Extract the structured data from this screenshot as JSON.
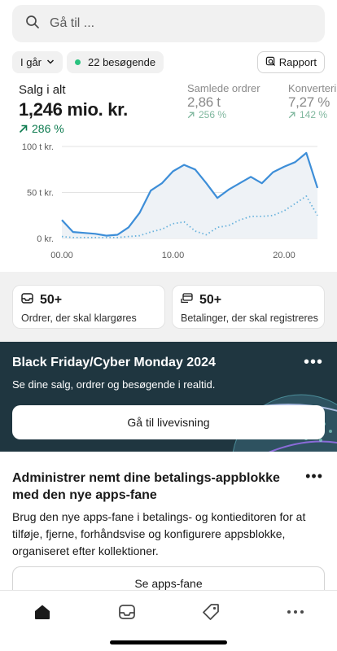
{
  "search": {
    "placeholder": "Gå til ..."
  },
  "filters": {
    "date": "I går",
    "visitors": "22 besøgende",
    "report": "Rapport"
  },
  "metrics": [
    {
      "label": "Salg i alt",
      "value": "1,246 mio. kr.",
      "change": "286 %"
    },
    {
      "label": "Samlede ordrer",
      "value": "2,86 t",
      "change": "256 %"
    },
    {
      "label": "Konvertering",
      "value": "7,27 %",
      "change": "142 %"
    }
  ],
  "chart_data": {
    "type": "line",
    "x_ticks": [
      "00.00",
      "10.00",
      "20.00"
    ],
    "y_ticks": [
      "100 t kr.",
      "50 t kr.",
      "0 kr."
    ],
    "ylim": [
      0,
      100
    ],
    "x": [
      0,
      1,
      2,
      3,
      4,
      5,
      6,
      7,
      8,
      9,
      10,
      11,
      12,
      13,
      14,
      15,
      16,
      17,
      18,
      19,
      20,
      21,
      22,
      23
    ],
    "series": [
      {
        "values": [
          20,
          7,
          6,
          5,
          3,
          4,
          12,
          28,
          52,
          60,
          73,
          80,
          75,
          60,
          44,
          53,
          60,
          67,
          60,
          72,
          78,
          83,
          93,
          55
        ],
        "color": "#3d8ed8",
        "style": "solid"
      },
      {
        "values": [
          2,
          1,
          1,
          1,
          1,
          1,
          2,
          3,
          7,
          10,
          16,
          18,
          8,
          4,
          12,
          14,
          20,
          24,
          24,
          25,
          30,
          38,
          46,
          25
        ],
        "color": "#68b2dc",
        "style": "dotted"
      }
    ]
  },
  "tasks": [
    {
      "count": "50+",
      "label": "Ordrer, der skal klargøres"
    },
    {
      "count": "50+",
      "label": "Betalinger, der skal registreres"
    }
  ],
  "promo": {
    "title": "Black Friday/Cyber Monday 2024",
    "subtitle": "Se dine salg, ordrer og besøgende i realtid.",
    "button": "Gå til livevisning"
  },
  "feature": {
    "title": "Administrer nemt dine betalings-appblokke med den nye apps-fane",
    "body": "Brug den nye apps-fane i betalings- og kontieditoren for at tilføje, fjerne, forhåndsvise og konfigurere appsblokke, organiseret efter kollektioner.",
    "button": "Se apps-fane"
  },
  "tabs": [
    "home-icon",
    "inbox-icon",
    "tag-icon",
    "more-icon"
  ]
}
